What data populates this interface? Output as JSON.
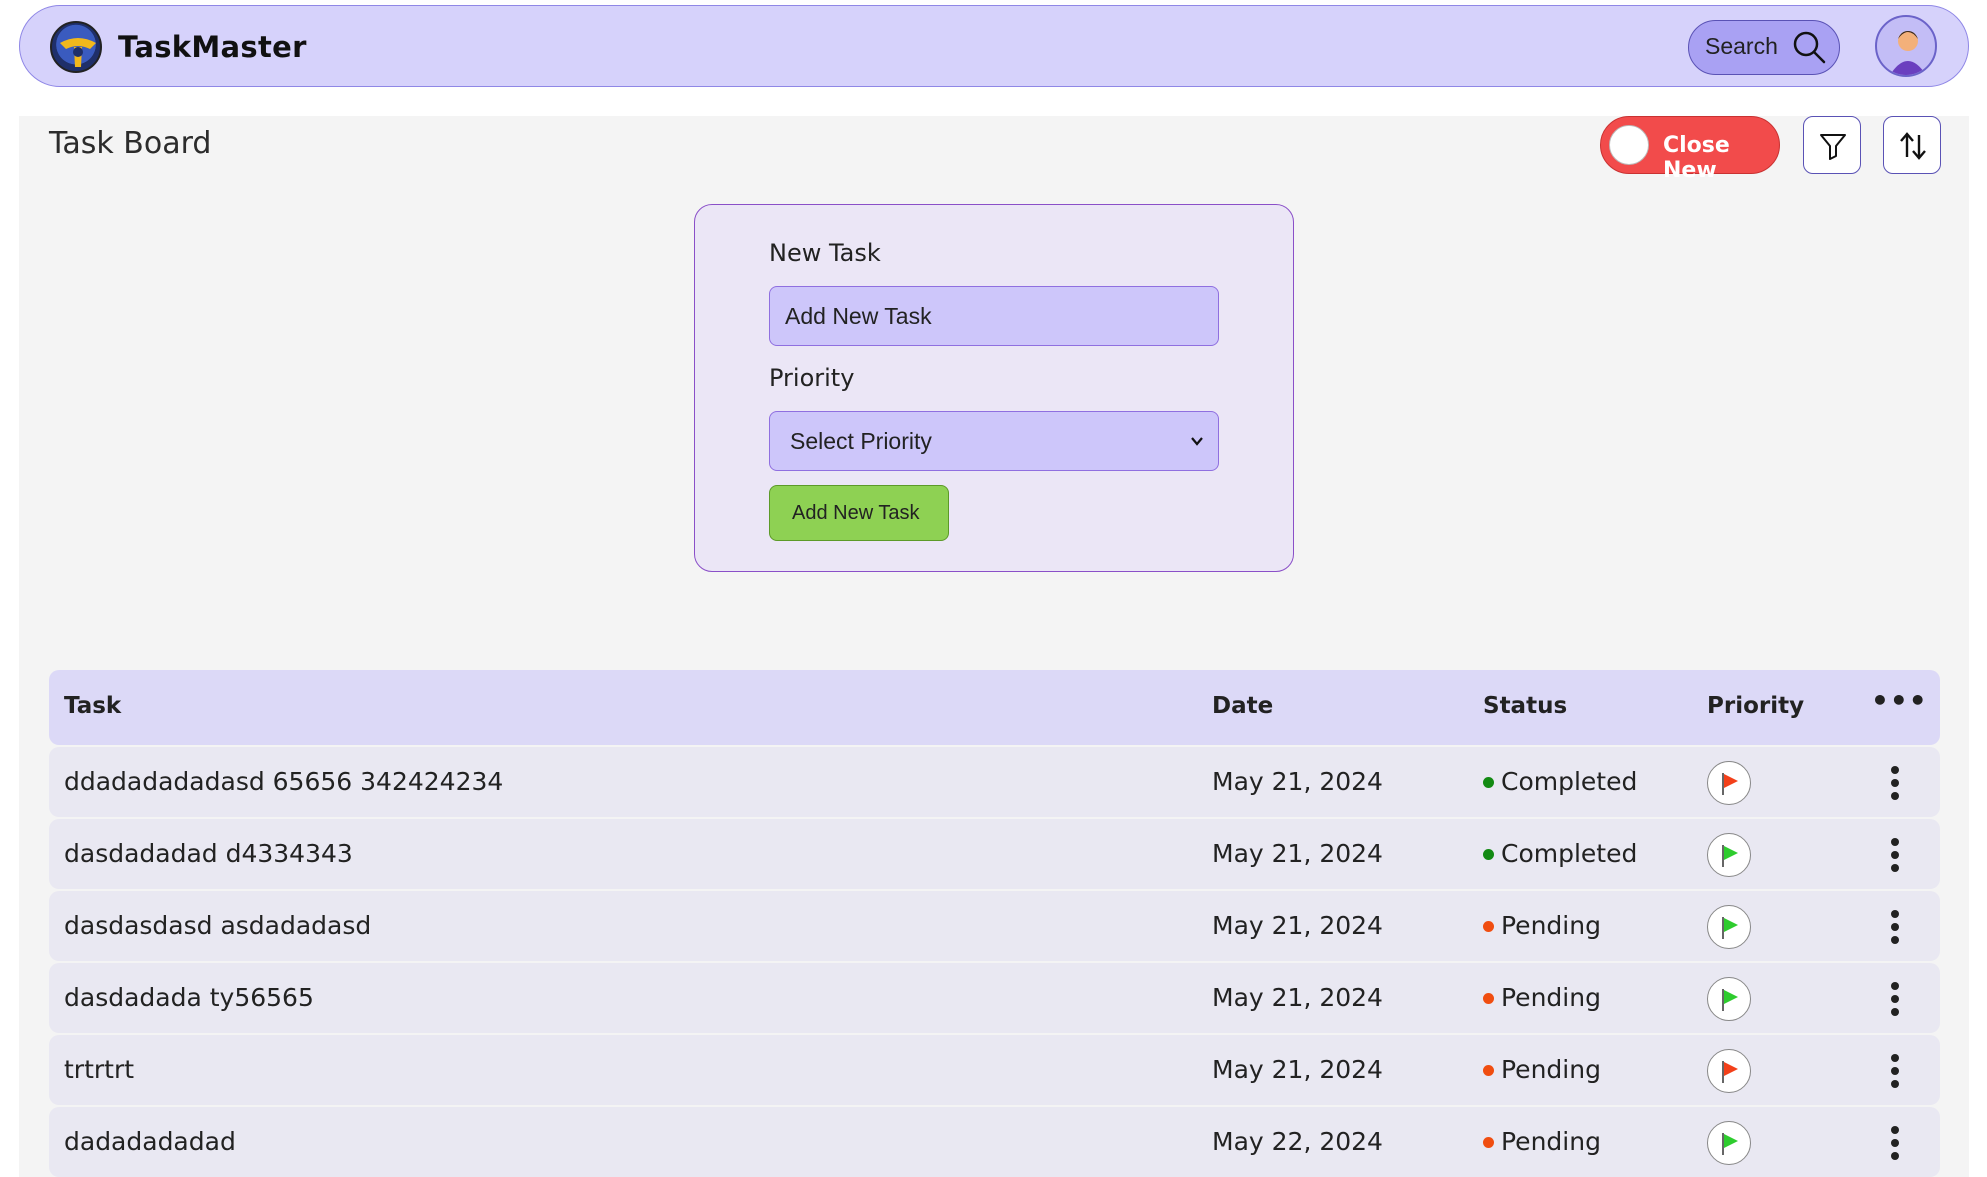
{
  "app": {
    "brand": "TaskMaster"
  },
  "header": {
    "search_label": "Search",
    "search_icon": "search-icon",
    "avatar_icon": "user-avatar-icon"
  },
  "toolbar": {
    "page_title": "Task Board",
    "close_new_label": "Close New",
    "filter_icon": "filter-icon",
    "sort_icon": "sort-icon"
  },
  "form": {
    "new_task_label": "New Task",
    "task_input_placeholder": "Add New Task",
    "task_input_value": "",
    "priority_label": "Priority",
    "priority_selected": "Select Priority",
    "submit_label": "Add New Task"
  },
  "table": {
    "headers": {
      "task": "Task",
      "date": "Date",
      "status": "Status",
      "priority": "Priority",
      "more": "•••"
    },
    "rows": [
      {
        "task": "ddadadadadasd 65656 342424234",
        "date": "May 21, 2024",
        "status": "Completed",
        "priority_flag": "red"
      },
      {
        "task": "dasdadadad d4334343",
        "date": "May 21, 2024",
        "status": "Completed",
        "priority_flag": "green"
      },
      {
        "task": "dasdasdasd asdadadasd",
        "date": "May 21, 2024",
        "status": "Pending",
        "priority_flag": "green"
      },
      {
        "task": "dasdadada ty56565",
        "date": "May 21, 2024",
        "status": "Pending",
        "priority_flag": "green"
      },
      {
        "task": "trtrtrt",
        "date": "May 21, 2024",
        "status": "Pending",
        "priority_flag": "red"
      },
      {
        "task": "dadadadadad",
        "date": "May 22, 2024",
        "status": "Pending",
        "priority_flag": "green"
      }
    ]
  },
  "colors": {
    "completed": "#138a13",
    "pending": "#f04d10",
    "flag_red": "#f3401a",
    "flag_green": "#2ecc2e"
  }
}
